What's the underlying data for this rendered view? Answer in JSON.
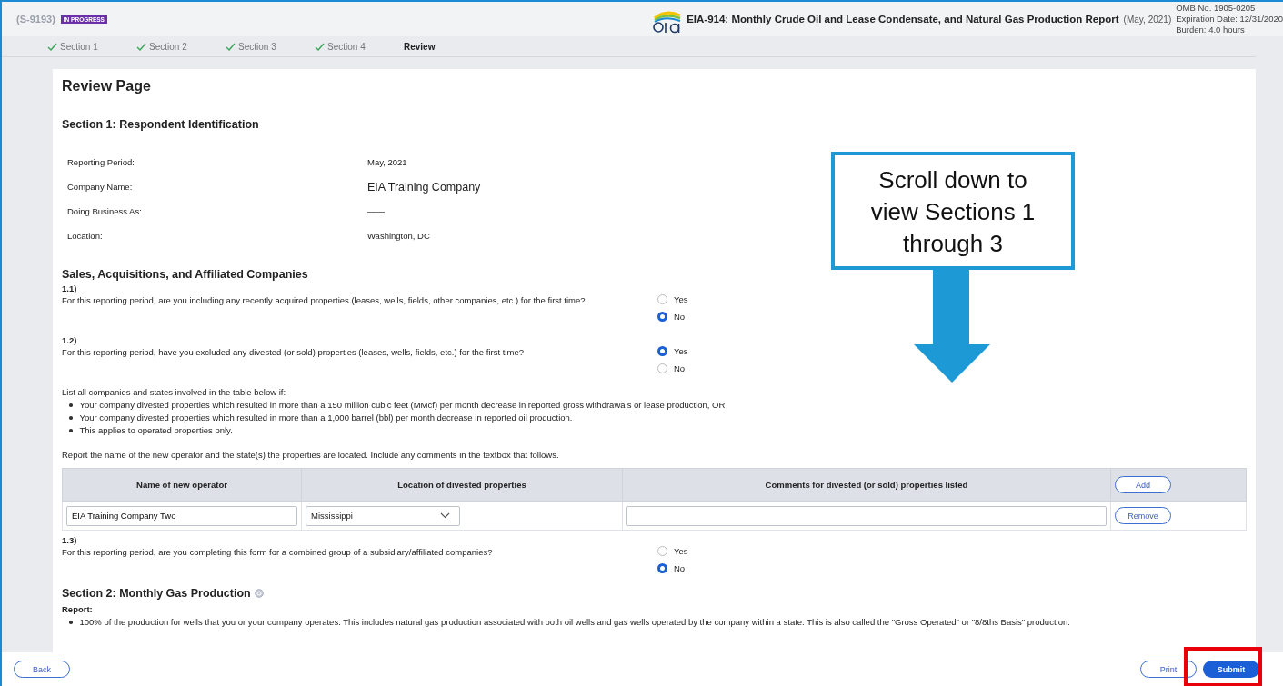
{
  "header": {
    "case_id": "(S-9193)",
    "status_badge": "IN PROGRESS",
    "form_title": "EIA-914: Monthly Crude Oil and Lease Condensate, and Natural Gas Production Report",
    "period": "(May, 2021)",
    "omb": "OMB No. 1905-0205",
    "expiration": "Expiration Date: 12/31/2020",
    "burden": "Burden: 4.0 hours"
  },
  "steps": [
    {
      "label": "Section 1",
      "completed": true,
      "selected": false
    },
    {
      "label": "Section 2",
      "completed": true,
      "selected": false
    },
    {
      "label": "Section 3",
      "completed": true,
      "selected": false
    },
    {
      "label": "Section 4",
      "completed": true,
      "selected": false
    },
    {
      "label": "Review",
      "completed": false,
      "selected": true
    }
  ],
  "page_title": "Review Page",
  "section1": {
    "heading": "Section 1: Respondent Identification",
    "fields": [
      {
        "label": "Reporting Period:",
        "value": "May, 2021",
        "emphasis": false
      },
      {
        "label": "Company Name:",
        "value": "EIA Training Company",
        "emphasis": true
      },
      {
        "label": "Doing Business As:",
        "value": "——",
        "emphasis": false
      },
      {
        "label": "Location:",
        "value": "Washington, DC",
        "emphasis": false
      }
    ]
  },
  "sales": {
    "heading": "Sales, Acquisitions, and Affiliated Companies",
    "blocks": [
      {
        "kind": "question",
        "number": "1.1)",
        "text": "For this reporting period, are you including any recently acquired properties (leases, wells, fields, other companies, etc.) for the first time?",
        "options": [
          {
            "label": "Yes",
            "selected": false
          },
          {
            "label": "No",
            "selected": true
          }
        ]
      },
      {
        "kind": "question",
        "number": "1.2)",
        "text": "For this reporting period, have you excluded any divested (or sold) properties (leases, wells, fields, etc.) for the first time?",
        "options": [
          {
            "label": "Yes",
            "selected": true
          },
          {
            "label": "No",
            "selected": false
          }
        ]
      },
      {
        "kind": "list",
        "intro": "List all companies and states involved in the table below if:",
        "items": [
          "Your company divested properties which resulted in more than a 150 million cubic feet (MMcf) per month decrease in reported gross withdrawals or lease production, OR",
          "Your company divested properties which resulted in more than a 1,000 barrel (bbl) per month decrease in reported oil production.",
          "This applies to operated properties only."
        ]
      },
      {
        "kind": "paragraph",
        "text": "Report the name of the new operator and the state(s) the properties are located. Include any comments in the textbox that follows."
      },
      {
        "kind": "table",
        "columns": [
          "Name of new operator",
          "Location of divested properties",
          "Comments for divested (or sold) properties listed"
        ],
        "add_button": "Add",
        "rows": [
          {
            "operator": "EIA Training Company Two",
            "location": "Mississippi",
            "remove_button": "Remove"
          }
        ]
      },
      {
        "kind": "question",
        "number": "1.3)",
        "text": "For this reporting period, are you completing this form for a combined group of a subsidiary/affiliated companies?",
        "options": [
          {
            "label": "Yes",
            "selected": false
          },
          {
            "label": "No",
            "selected": true
          }
        ]
      }
    ]
  },
  "section2": {
    "heading": "Section 2: Monthly Gas Production",
    "report_label": "Report:",
    "items": [
      "100% of the production for wells that you or your company operates. This includes natural gas production associated with both oil wells and gas wells operated by the company within a state. This is also called the \"Gross Operated\" or \"8/8ths Basis\" production."
    ]
  },
  "footer": {
    "back": "Back",
    "print": "Print",
    "submit": "Submit"
  },
  "annotation": {
    "callout": "Scroll down to view Sections 1 through 3"
  }
}
